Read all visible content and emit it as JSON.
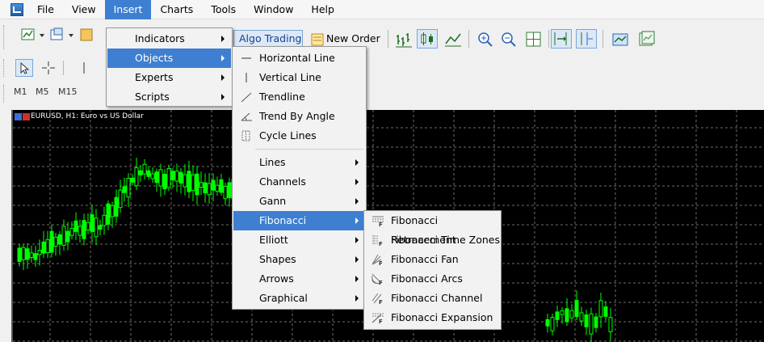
{
  "menubar": {
    "items": [
      "File",
      "View",
      "Insert",
      "Charts",
      "Tools",
      "Window",
      "Help"
    ],
    "active": "Insert"
  },
  "toolbar": {
    "algo_trading_label": "Algo Trading",
    "new_order_label": "New Order"
  },
  "timeframes": [
    "M1",
    "M5",
    "M15"
  ],
  "chart": {
    "title": "EURUSD, H1:  Euro vs US Dollar",
    "background": "#000000",
    "grid_color": "#6e6e6e",
    "candle_color": "#00ff00"
  },
  "insert_menu": {
    "items": [
      "Indicators",
      "Objects",
      "Experts",
      "Scripts"
    ],
    "highlighted": "Objects"
  },
  "objects_menu": {
    "items": [
      "Horizontal Line",
      "Vertical Line",
      "Trendline",
      "Trend By Angle",
      "Cycle Lines"
    ],
    "groups": [
      "Lines",
      "Channels",
      "Gann",
      "Fibonacci",
      "Elliott",
      "Shapes",
      "Arrows",
      "Graphical"
    ],
    "highlighted": "Fibonacci"
  },
  "fibonacci_menu": {
    "items": [
      "Fibonacci Retracement",
      "Fibonacci Time Zones",
      "Fibonacci Fan",
      "Fibonacci Arcs",
      "Fibonacci Channel",
      "Fibonacci Expansion"
    ]
  },
  "colors": {
    "menu_highlight": "#3e7fd1",
    "menu_bg": "#f2f2f2"
  }
}
